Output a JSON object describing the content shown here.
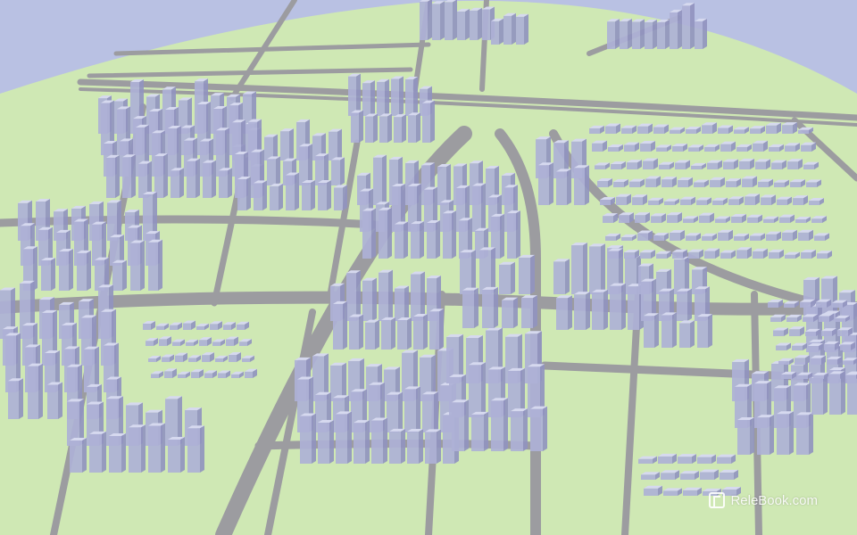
{
  "scene": {
    "subject": "",
    "colors": {
      "sky": "#b9c1e3",
      "ground": "#cfe8b4",
      "ground_edge": "#c3e0a4",
      "road": "#9c9ca0",
      "road_light": "#b3b3b6",
      "building_face": "#aeb1d6",
      "building_side": "#9194bf",
      "building_top": "#d6d9ef"
    }
  },
  "watermark": {
    "text": "ReleBook.com",
    "icon": "relebook-logo-icon"
  }
}
